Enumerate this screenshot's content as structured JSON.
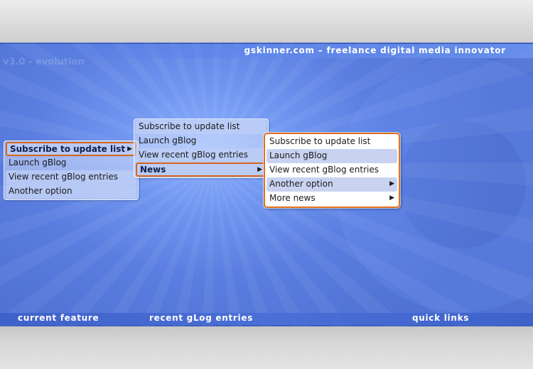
{
  "header": {
    "site_title": "gskinner.com – freelance digital media innovator",
    "version_text": "v3.0 - evolution"
  },
  "menus": {
    "menu1": {
      "items": [
        {
          "label": "Subscribe to update list",
          "has_submenu": true,
          "active": true
        },
        {
          "label": "Launch gBlog"
        },
        {
          "label": "View recent gBlog entries"
        },
        {
          "label": "Another option"
        }
      ]
    },
    "menu2": {
      "items": [
        {
          "label": "Subscribe to update list"
        },
        {
          "label": "Launch gBlog"
        },
        {
          "label": "View recent gBlog entries"
        },
        {
          "label": "News",
          "has_submenu": true,
          "active": true
        }
      ]
    },
    "menu3": {
      "items": [
        {
          "label": "Subscribe to update list"
        },
        {
          "label": "Launch gBlog"
        },
        {
          "label": "View recent gBlog entries"
        },
        {
          "label": "Another option",
          "has_submenu": true
        },
        {
          "label": "More news",
          "has_submenu": true
        }
      ]
    }
  },
  "footer": {
    "current_feature": "current feature",
    "recent_entries": "recent gLog entries",
    "quick_links": "quick links"
  },
  "colors": {
    "accent_orange": "#e0701f",
    "stage_blue": "#5a7ee0",
    "footer_bar": "#4a6fd6"
  },
  "icons": {
    "submenu_arrow": "submenu-arrow-icon"
  }
}
